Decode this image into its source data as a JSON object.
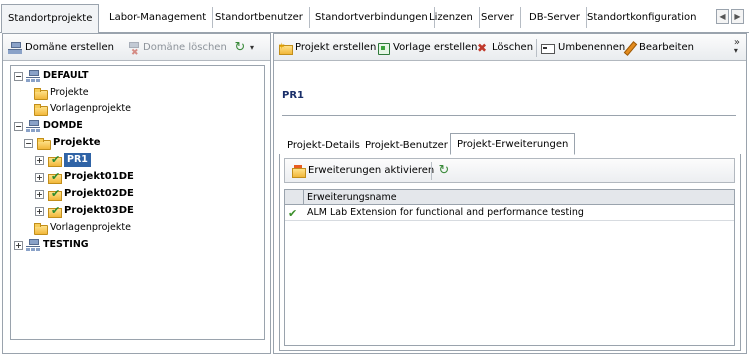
{
  "colors": {
    "selection_bg": "#2f63a6",
    "border": "#9aa3ad",
    "title_blue": "#1a2f6a",
    "check_green": "#3b8f2a"
  },
  "top_tabs": [
    "Standortprojekte",
    "Labor-Management",
    "Standortbenutzer",
    "Standortverbindungen",
    "Lizenzen",
    "Server",
    "DB-Server",
    "Standortkonfiguration"
  ],
  "left_toolbar": {
    "create_domain": "Domäne erstellen",
    "delete_domain": "Domäne löschen",
    "refresh_icon": "refresh-icon"
  },
  "right_toolbar": {
    "create_project": "Projekt erstellen",
    "create_template": "Vorlage erstellen",
    "delete": "Löschen",
    "rename": "Umbenennen",
    "edit": "Bearbeiten",
    "more": "»"
  },
  "tree": [
    {
      "label": "DEFAULT",
      "icon": "domain-icon",
      "expander": "−",
      "bold": true
    },
    {
      "label": "Projekte",
      "icon": "folder-icon"
    },
    {
      "label": "Vorlagenprojekte",
      "icon": "folder-icon"
    },
    {
      "label": "DOMDE",
      "icon": "domain-icon",
      "expander": "−",
      "bold": true
    },
    {
      "label": "Projekte",
      "icon": "folder-icon",
      "expander": "−",
      "bold": true
    },
    {
      "label": "PR1",
      "icon": "project-icon",
      "expander": "+",
      "bold": true,
      "selected": true
    },
    {
      "label": "Projekt01DE",
      "icon": "project-icon",
      "expander": "+",
      "bold": true
    },
    {
      "label": "Projekt02DE",
      "icon": "project-icon",
      "expander": "+",
      "bold": true
    },
    {
      "label": "Projekt03DE",
      "icon": "project-icon",
      "expander": "+",
      "bold": true
    },
    {
      "label": "Vorlagenprojekte",
      "icon": "folder-icon"
    },
    {
      "label": "TESTING",
      "icon": "domain-icon",
      "expander": "+",
      "bold": true
    }
  ],
  "project": {
    "title": "PR1"
  },
  "sub_tabs": [
    "Projekt-Details",
    "Projekt-Benutzer",
    "Projekt-Erweiterungen"
  ],
  "extensions": {
    "activate_label": "Erweiterungen aktivieren",
    "column_header": "Erweiterungsname",
    "rows": [
      {
        "name": "ALM Lab Extension for functional and performance testing",
        "enabled": true
      }
    ]
  }
}
